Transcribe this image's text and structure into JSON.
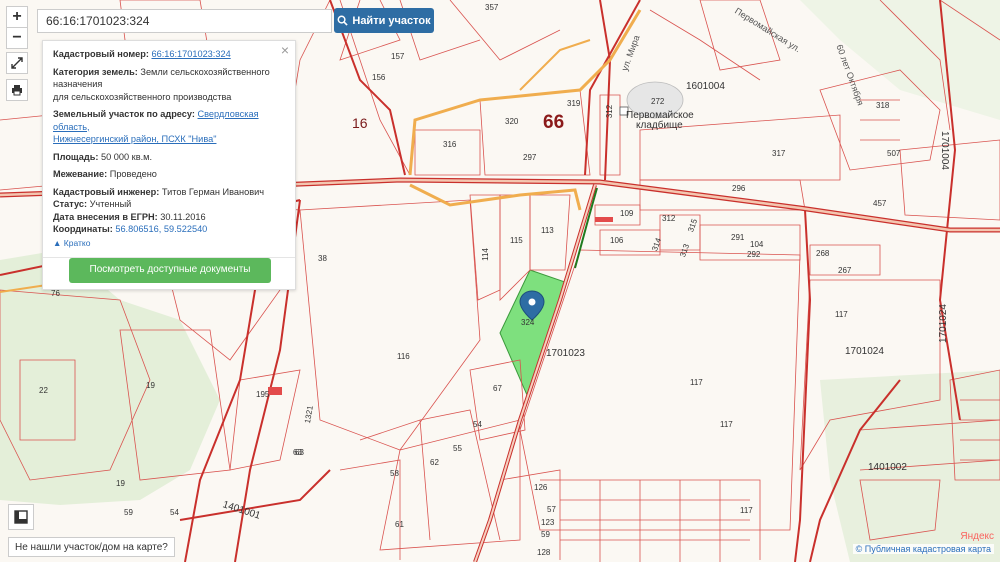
{
  "search": {
    "value": "66:16:1701023:324",
    "button_label": "Найти участок"
  },
  "controls": {
    "zoom_in": "+",
    "zoom_out": "−"
  },
  "info": {
    "cadastral_label": "Кадастровый номер:",
    "cadastral_value": "66:16:1701023:324",
    "category_label": "Категория земель:",
    "category_value_1": "Земли сельскохозяйственного",
    "category_value_2": "назначения",
    "category_value_3": "для сельскохозяйственного производства",
    "address_label": "Земельный участок по адресу:",
    "address_link_1": "Свердловская область,",
    "address_link_2": "Нижнесергинский район, ПСХК \"Нива\"",
    "area_label": "Площадь:",
    "area_value": "50 000 кв.м.",
    "survey_label": "Межевание:",
    "survey_value": "Проведено",
    "engineer_label": "Кадастровый инженер:",
    "engineer_value": "Титов Герман Иванович",
    "status_label": "Статус:",
    "status_value": "Учтенный",
    "date_label": "Дата внесения в ЕГРН:",
    "date_value": "30.11.2016",
    "coords_label": "Координаты:",
    "coords_value": "56.806516, 59.522540",
    "collapse": "Кратко",
    "docs_button": "Посмотреть доступные документы"
  },
  "bottom": {
    "not_found": "Не нашли участок/дом на карте?",
    "attribution": "© Публичная кадастровая карта",
    "provider": "Яндекс"
  },
  "map_labels": {
    "district_66": "66",
    "road_16": "16",
    "cemetery_1": "Первомайское",
    "cemetery_2": "кладбище",
    "street_mira": "ул. Мира",
    "street_pervomaiskaya": "Первомайская ул.",
    "street_oktyabrya": "60 лет Октября",
    "q_1701004": "1601004",
    "q_1701004v": "1701004",
    "q_1701023": "1701023",
    "q_1701024": "1701024",
    "q_1701024v": "1701024",
    "q_1401002": "1401002",
    "q_1401001": "1401001",
    "parcels": [
      "357",
      "272",
      "319",
      "320",
      "316",
      "312",
      "297",
      "317",
      "296",
      "457",
      "507",
      "109",
      "312",
      "315",
      "115",
      "113",
      "114",
      "106",
      "314",
      "313",
      "291",
      "104",
      "292",
      "268",
      "267",
      "38",
      "76",
      "116",
      "117",
      "324",
      "67",
      "54",
      "55",
      "62",
      "58",
      "61",
      "63",
      "195",
      "1321",
      "22",
      "19",
      "19",
      "59",
      "54",
      "117",
      "117",
      "126",
      "57",
      "123",
      "59",
      "128",
      "156",
      "157",
      "318",
      "63",
      "117",
      "1701023"
    ]
  },
  "colors": {
    "boundary": "#d9534f",
    "road_orange": "#f0ad4e",
    "road_red": "#c9302c",
    "selected_parcel": "#7ee07e",
    "button_blue": "#2e6da4",
    "button_green": "#5cb85c",
    "background": "#fbf8f3"
  }
}
